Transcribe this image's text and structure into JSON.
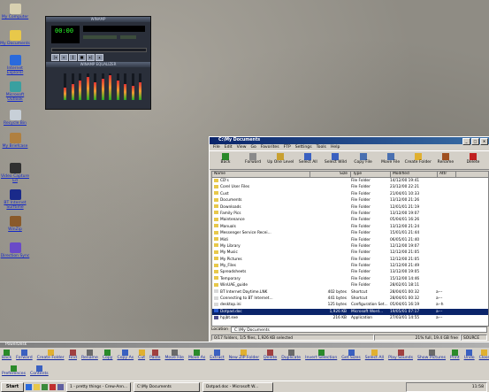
{
  "desktop_icons": [
    {
      "label": "My Computer",
      "color": "#d8d0b0"
    },
    {
      "label": "My Documents",
      "color": "#e8c84a"
    },
    {
      "label": "Internet Explorer",
      "color": "#2a6adc"
    },
    {
      "label": "Microsoft Outlook",
      "color": "#3aa0a0"
    },
    {
      "label": "Recycle Bin",
      "color": "#c8d0d8"
    },
    {
      "label": "My Briefcase",
      "color": "#b08040"
    },
    {
      "label": "Video Capture Ed",
      "color": "#303030"
    },
    {
      "label": "BT Internet Surftime",
      "color": "#1a2a8a"
    },
    {
      "label": "WinZip",
      "color": "#8a5a2a"
    },
    {
      "label": "Direction Sync",
      "color": "#6a4ac8"
    }
  ],
  "winamp": {
    "title": "WINAMP",
    "eq_title": "WINAMP EQUALIZER",
    "time": "00:00"
  },
  "explorer": {
    "title": "C:\\My Documents",
    "menu": [
      "File",
      "Edit",
      "View",
      "Go",
      "Favorites",
      "FTP",
      "Settings",
      "Tools",
      "Help"
    ],
    "toolbar": [
      "Back",
      "Forward",
      "Up One Level",
      "Select All",
      "Select Wild",
      "Copy File",
      "Move File",
      "Create Folder",
      "Rename",
      "Delete"
    ],
    "columns": [
      "Name",
      "Size",
      "Type",
      "Modified",
      "Attr"
    ],
    "rows": [
      {
        "name": "CD's",
        "size": "",
        "type": "File Folder",
        "modified": "14/12/00 19:41",
        "attr": "",
        "icon": "folder"
      },
      {
        "name": "Corel User Files",
        "size": "",
        "type": "File Folder",
        "modified": "23/12/00 22:21",
        "attr": "",
        "icon": "folder"
      },
      {
        "name": "Cust",
        "size": "",
        "type": "File Folder",
        "modified": "21/04/01 10:33",
        "attr": "",
        "icon": "folder"
      },
      {
        "name": "Documents",
        "size": "",
        "type": "File Folder",
        "modified": "13/12/00 21:26",
        "attr": "",
        "icon": "folder"
      },
      {
        "name": "Downloads",
        "size": "",
        "type": "File Folder",
        "modified": "12/01/01 21:19",
        "attr": "",
        "icon": "folder"
      },
      {
        "name": "Family Pics",
        "size": "",
        "type": "File Folder",
        "modified": "13/12/00 19:07",
        "attr": "",
        "icon": "folder"
      },
      {
        "name": "Maintenance",
        "size": "",
        "type": "File Folder",
        "modified": "05/04/01 16:26",
        "attr": "",
        "icon": "folder"
      },
      {
        "name": "Manuals",
        "size": "",
        "type": "File Folder",
        "modified": "13/12/00 21:24",
        "attr": "",
        "icon": "folder"
      },
      {
        "name": "Messenger Service Recei...",
        "size": "",
        "type": "File Folder",
        "modified": "15/01/01 21:44",
        "attr": "",
        "icon": "folder"
      },
      {
        "name": "Midi",
        "size": "",
        "type": "File Folder",
        "modified": "06/05/01 21:40",
        "attr": "",
        "icon": "folder"
      },
      {
        "name": "My Library",
        "size": "",
        "type": "File Folder",
        "modified": "12/12/00 19:07",
        "attr": "",
        "icon": "folder"
      },
      {
        "name": "My Music",
        "size": "",
        "type": "File Folder",
        "modified": "12/12/00 21:05",
        "attr": "",
        "icon": "folder"
      },
      {
        "name": "My Pictures",
        "size": "",
        "type": "File Folder",
        "modified": "12/12/00 21:05",
        "attr": "",
        "icon": "folder"
      },
      {
        "name": "My_Files",
        "size": "",
        "type": "File Folder",
        "modified": "12/12/00 21:49",
        "attr": "",
        "icon": "folder"
      },
      {
        "name": "Spreadsheets",
        "size": "",
        "type": "File Folder",
        "modified": "13/12/00 19:05",
        "attr": "",
        "icon": "folder"
      },
      {
        "name": "Temporary",
        "size": "",
        "type": "File Folder",
        "modified": "15/12/00 14:46",
        "attr": "",
        "icon": "folder"
      },
      {
        "name": "WinUAE_guide",
        "size": "",
        "type": "File Folder",
        "modified": "28/02/01 18:11",
        "attr": "",
        "icon": "folder"
      },
      {
        "name": "BT Internet Daytime.LNK",
        "size": "402 bytes",
        "type": "Shortcut",
        "modified": "28/04/01 00:32",
        "attr": "a---",
        "icon": "file"
      },
      {
        "name": "Connecting to BT Internet...",
        "size": "441 bytes",
        "type": "Shortcut",
        "modified": "28/04/01 00:32",
        "attr": "a---",
        "icon": "file"
      },
      {
        "name": "desktop.ini",
        "size": "125 bytes",
        "type": "Configuration Set...",
        "modified": "05/04/01 16:19",
        "attr": "a--h",
        "icon": "file"
      },
      {
        "name": "Dotpad.doc",
        "size": "1,926 KB",
        "type": "Microsoft Word...",
        "modified": "19/05/01 07:17",
        "attr": "a---",
        "icon": "doc",
        "selected": true
      },
      {
        "name": "hpjbt.exe",
        "size": "216 KB",
        "type": "Application",
        "modified": "27/03/01 14:55",
        "attr": "a---",
        "icon": "exe"
      }
    ],
    "location_label": "Location",
    "location_value": "C:\\My Documents",
    "status_left": "0/17 folders, 1/5 files, 1,926 KB selected",
    "status_free": "21% full, 19.4 GB free",
    "status_source": "SOURCE"
  },
  "bottombar": {
    "title": "PowerDesk",
    "row1": [
      "Back",
      "Forward",
      "Create Folder",
      "Find",
      "Rename",
      "Copy",
      "Copy As",
      "Cut",
      "Paste",
      "Move File",
      "Move As",
      "Extract",
      "New ZIP Folder",
      "Delete",
      "Duplicate",
      "Invert Selection",
      "Get Sizes",
      "Select All",
      "Play Sounds",
      "Show Pictures",
      "Print",
      "Undo",
      "Close"
    ],
    "row2": [
      "Preferences",
      "Contents"
    ]
  },
  "taskbar": {
    "start": "Start",
    "tasks": [
      "1 - pretty things - Crew-Ann...",
      "C:\\My Documents",
      "Dotpad.doc - Microsoft W..."
    ],
    "clock": "11:58"
  }
}
